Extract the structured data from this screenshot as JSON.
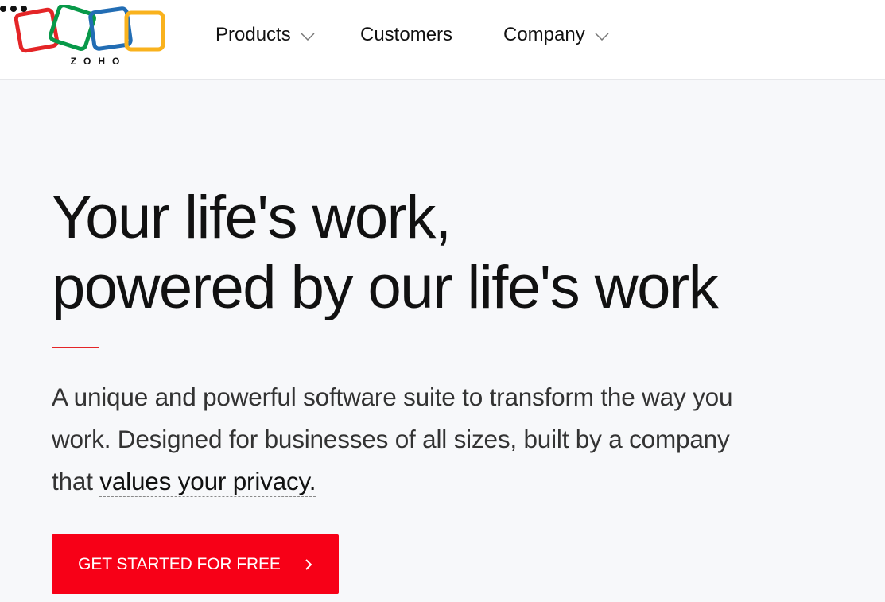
{
  "brand": {
    "logo_text": "ZOHO",
    "colors": {
      "red": "#e42527",
      "green": "#089949",
      "blue": "#226db4",
      "yellow": "#f9b21d"
    }
  },
  "nav": {
    "products_label": "Products",
    "customers_label": "Customers",
    "company_label": "Company",
    "more_icon": "more-dots-icon",
    "chevron_icon": "chevron-down-icon"
  },
  "hero": {
    "headline_line1": "Your life's work,",
    "headline_line2": "powered by our life's work",
    "subtext_part1": "A unique and powerful software suite to transform the way you work. Designed for businesses of all sizes, built by a company that ",
    "privacy_link": "values your privacy.",
    "cta_label": "GET STARTED FOR FREE",
    "cta_icon": "chevron-right-icon",
    "cta_color": "#f70017",
    "accent_rule_color": "#e42527"
  }
}
